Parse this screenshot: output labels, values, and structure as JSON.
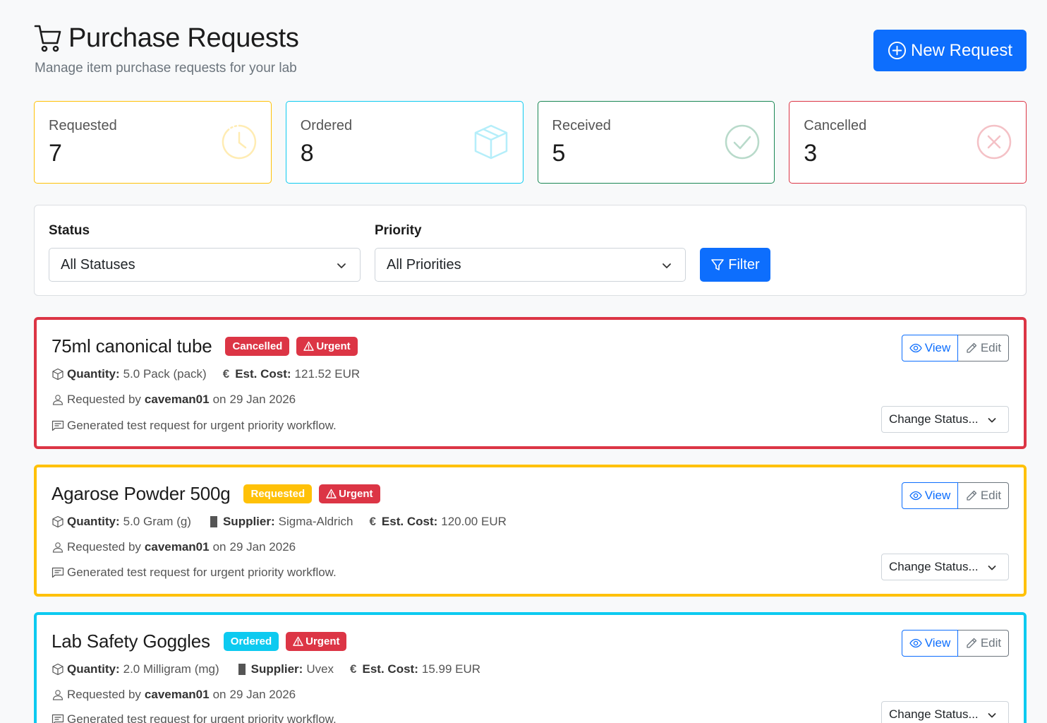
{
  "header": {
    "title": "Purchase Requests",
    "subtitle": "Manage item purchase requests for your lab",
    "new_button_label": "New Request"
  },
  "stats": [
    {
      "label": "Requested",
      "value": "7",
      "color": "#ffc107",
      "icon": "clock-icon"
    },
    {
      "label": "Ordered",
      "value": "8",
      "color": "#0dcaf0",
      "icon": "box-icon"
    },
    {
      "label": "Received",
      "value": "5",
      "color": "#198754",
      "icon": "check-circle-icon"
    },
    {
      "label": "Cancelled",
      "value": "3",
      "color": "#dc3545",
      "icon": "x-circle-icon"
    }
  ],
  "filters": {
    "status_label": "Status",
    "status_value": "All Statuses",
    "priority_label": "Priority",
    "priority_value": "All Priorities",
    "filter_button_label": "Filter"
  },
  "labels": {
    "quantity": "Quantity:",
    "supplier": "Supplier:",
    "est_cost": "Est. Cost:",
    "requested_by": "Requested by",
    "on": "on",
    "view": "View",
    "edit": "Edit",
    "change_status": "Change Status..."
  },
  "requests": [
    {
      "title": "75ml canonical tube",
      "status": "Cancelled",
      "status_color": "#dc3545",
      "priority": "Urgent",
      "border_color": "#dc3545",
      "quantity": "5.0 Pack (pack)",
      "supplier": "",
      "est_cost": "121.52 EUR",
      "requester": "caveman01",
      "date": "29 Jan 2026",
      "note": "Generated test request for urgent priority workflow."
    },
    {
      "title": "Agarose Powder 500g",
      "status": "Requested",
      "status_color": "#ffc107",
      "priority": "Urgent",
      "border_color": "#ffc107",
      "quantity": "5.0 Gram (g)",
      "supplier": "Sigma-Aldrich",
      "est_cost": "120.00 EUR",
      "requester": "caveman01",
      "date": "29 Jan 2026",
      "note": "Generated test request for urgent priority workflow."
    },
    {
      "title": "Lab Safety Goggles",
      "status": "Ordered",
      "status_color": "#0dcaf0",
      "priority": "Urgent",
      "border_color": "#0dcaf0",
      "quantity": "2.0 Milligram (mg)",
      "supplier": "Uvex",
      "est_cost": "15.99 EUR",
      "requester": "caveman01",
      "date": "29 Jan 2026",
      "note": "Generated test request for urgent priority workflow."
    }
  ]
}
